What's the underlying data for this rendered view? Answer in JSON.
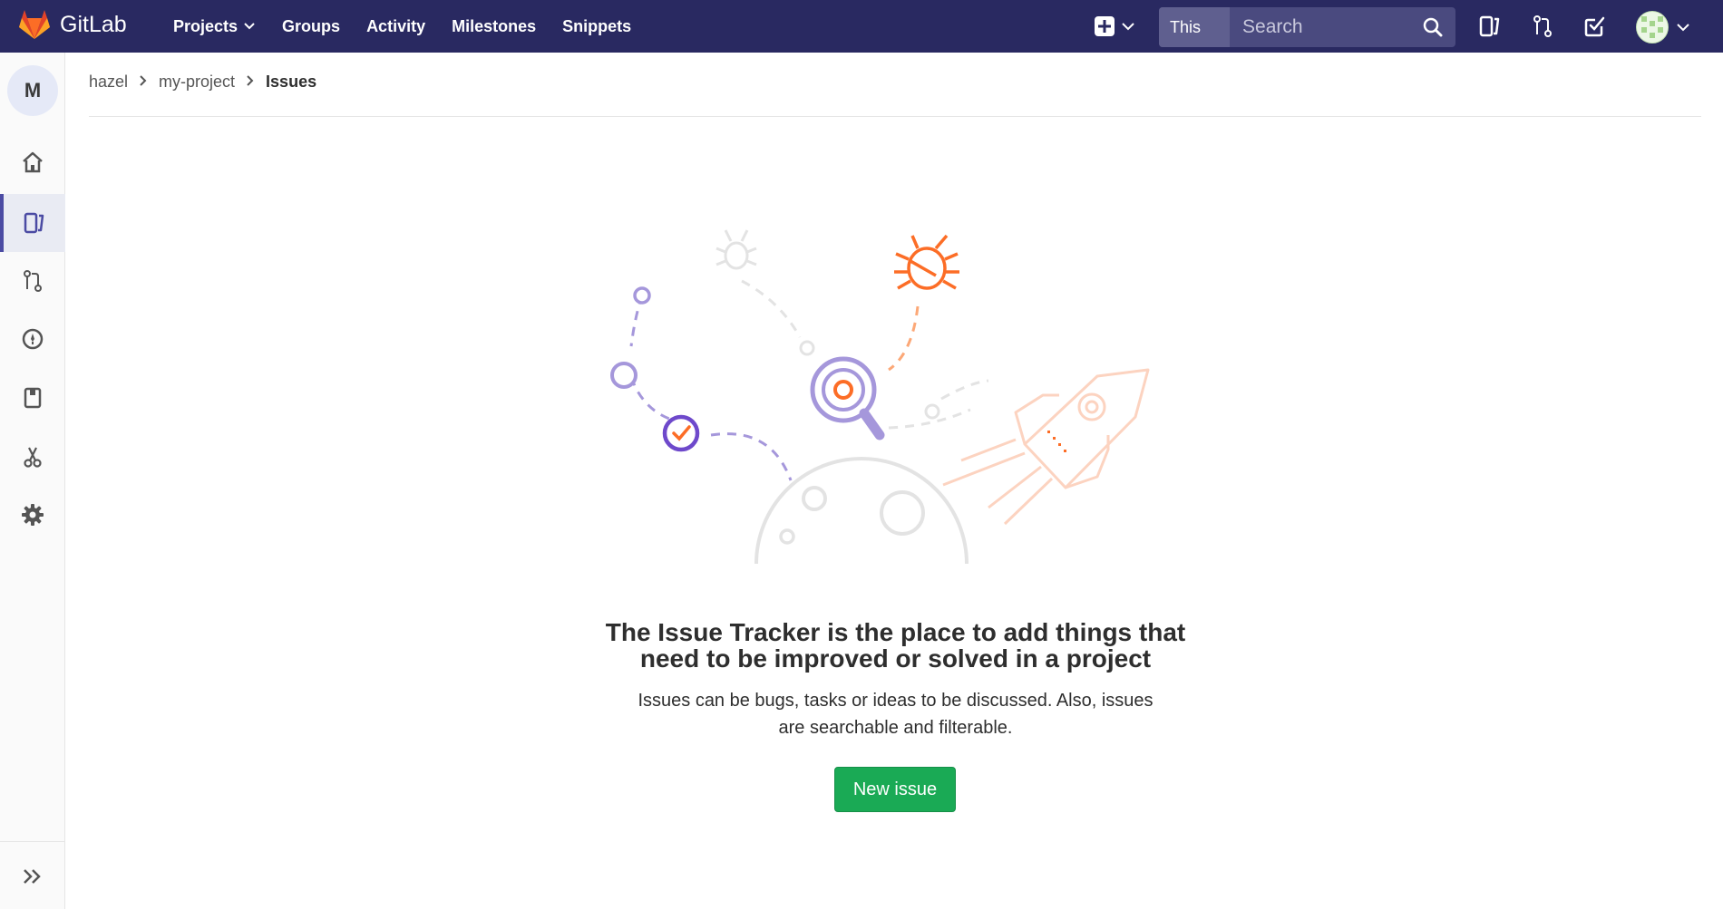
{
  "navbar": {
    "brand": "GitLab",
    "links": [
      {
        "label": "Projects",
        "has_caret": true
      },
      {
        "label": "Groups"
      },
      {
        "label": "Activity"
      },
      {
        "label": "Milestones"
      },
      {
        "label": "Snippets"
      }
    ],
    "search": {
      "scope": "This project",
      "placeholder": "Search"
    },
    "icons": [
      "plus-square-icon",
      "issues-icon",
      "merge-request-icon",
      "todo-check-icon",
      "user-avatar"
    ]
  },
  "sidebar": {
    "project_initial": "M",
    "items": [
      {
        "name": "project-overview",
        "icon": "home-icon"
      },
      {
        "name": "issues",
        "icon": "issues-icon",
        "active": true
      },
      {
        "name": "merge-requests",
        "icon": "merge-request-icon"
      },
      {
        "name": "ci-cd",
        "icon": "rocket-icon"
      },
      {
        "name": "wiki",
        "icon": "book-icon"
      },
      {
        "name": "snippets",
        "icon": "scissors-icon"
      },
      {
        "name": "settings",
        "icon": "gear-icon"
      }
    ],
    "collapse_icon": "double-chevron-right-icon"
  },
  "breadcrumb": {
    "items": [
      "hazel",
      "my-project"
    ],
    "current": "Issues"
  },
  "empty_state": {
    "title_line1": "The Issue Tracker is the place to add things that",
    "title_line2": "need to be improved or solved in a project",
    "text_line1": "Issues can be bugs, tasks or ideas to be discussed. Also, issues",
    "text_line2": "are searchable and filterable.",
    "button_label": "New issue"
  },
  "colors": {
    "navbar_bg": "#292961",
    "active_accent": "#4b4ba3",
    "primary_button": "#1aaa55",
    "illustration_purple": "#6e49cb",
    "illustration_orange": "#fc6d26"
  }
}
